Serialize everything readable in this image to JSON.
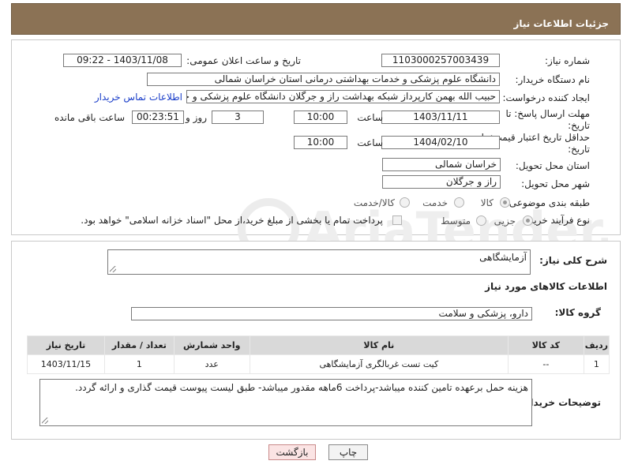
{
  "header": {
    "title": "جزئیات اطلاعات نیاز"
  },
  "form": {
    "need_number_label": "شماره نیاز:",
    "need_number": "1103000257003439",
    "announce_label": "تاریخ و ساعت اعلان عمومی:",
    "announce_value": "1403/11/08 - 09:22",
    "buyer_label": "نام دستگاه خریدار:",
    "buyer_value": "دانشگاه علوم پزشکی و خدمات بهداشتی درمانی استان خراسان شمالی",
    "creator_label": "ایجاد کننده درخواست:",
    "creator_value": "حبیب الله بهمن کارپرداز شبکه بهداشت راز و جرگلان دانشگاه علوم پزشکی و خد",
    "contact_link": "اطلاعات تماس خریدار",
    "deadline_label_1": "مهلت ارسال پاسخ: تا",
    "deadline_label_2": "تاریخ:",
    "deadline_date": "1403/11/11",
    "time_label": "ساعت",
    "deadline_time": "10:00",
    "days_value": "3",
    "days_label": "روز و",
    "remaining_value": "00:23:51",
    "remaining_label": "ساعت باقی مانده",
    "validity_label_1": "حداقل تاریخ اعتبار قیمت: تا",
    "validity_label_2": "تاریخ:",
    "validity_date": "1404/02/10",
    "validity_time_label": "ساعت",
    "validity_time": "10:00",
    "province_label": "استان محل تحویل:",
    "province_value": "خراسان شمالی",
    "city_label": "شهر محل تحویل:",
    "city_value": "راز و جرگلان",
    "category_label": "طبقه بندی موضوعی:",
    "category_options": [
      "کالا",
      "خدمت",
      "کالا/خدمت"
    ],
    "purchase_label": "نوع فرآیند خرید :",
    "purchase_options": [
      "جزیی",
      "متوسط"
    ],
    "payment_note": "پرداخت تمام یا بخشی از مبلغ خرید،از محل \"اسناد خزانه اسلامی\" خواهد بود."
  },
  "summary": {
    "desc_label": "شرح کلی نیاز:",
    "desc_value": "آزمایشگاهی",
    "goods_title": "اطلاعات کالاهای مورد نیاز",
    "group_label": "گروه کالا:",
    "group_value": "دارو، پزشکی و سلامت"
  },
  "table": {
    "headers": [
      "ردیف",
      "کد کالا",
      "نام کالا",
      "واحد شمارش",
      "تعداد / مقدار",
      "تاریخ نیاز"
    ],
    "rows": [
      [
        "1",
        "--",
        "کیت تست غربالگری آزمایشگاهی",
        "عدد",
        "1",
        "1403/11/15"
      ]
    ]
  },
  "notes": {
    "label": "توضیحات خریدار:",
    "value": "هزینه حمل برعهده تامین کننده میباشد-پرداخت 6ماهه مقدور میباشد- طبق لیست پیوست قیمت گذاری و ارائه گردد."
  },
  "buttons": {
    "print": "چاپ",
    "back": "بازگشت"
  },
  "watermark": {
    "brand": "AriaTender.net"
  },
  "colors": {
    "header_bg": "#8b7255",
    "link": "#1a3ec9",
    "back_button": "#fbe4e4"
  }
}
